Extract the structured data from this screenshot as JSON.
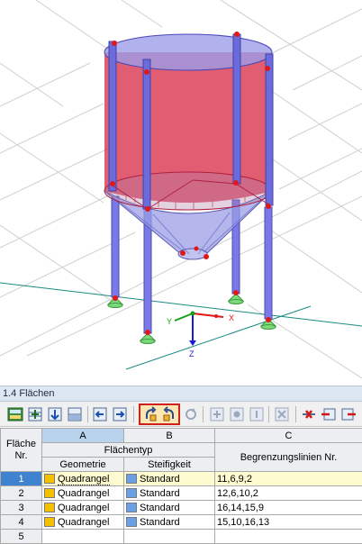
{
  "viewport": {
    "axis_y_label": "Y",
    "axis_x_label": "X",
    "axis_z_label": "Z"
  },
  "panel": {
    "title": "1.4 Flächen"
  },
  "toolbar": {
    "buttons": [
      "table-view-icon",
      "insert-row-icon",
      "export-icon",
      "import-icon",
      "prev-icon",
      "next-icon",
      "rotate-left-icon",
      "rotate-right-icon",
      "refresh-icon",
      "zoom-icon",
      "settings-icon",
      "filter-icon",
      "select-icon",
      "delete-icon",
      "delete-row-icon",
      "insert-col-icon"
    ]
  },
  "table": {
    "col_letters": [
      "A",
      "B",
      "C"
    ],
    "rowhead_line1": "Fläche",
    "rowhead_line2": "Nr.",
    "group_header": "Flächentyp",
    "col_headers": [
      "Geometrie",
      "Steifigkeit",
      "Begrenzungslinien Nr."
    ],
    "rows": [
      {
        "nr": "1",
        "geometrie": "Quadrangel",
        "steifigkeit": "Standard",
        "linien": "11,6,9,2"
      },
      {
        "nr": "2",
        "geometrie": "Quadrangel",
        "steifigkeit": "Standard",
        "linien": "12,6,10,2"
      },
      {
        "nr": "3",
        "geometrie": "Quadrangel",
        "steifigkeit": "Standard",
        "linien": "16,14,15,9"
      },
      {
        "nr": "4",
        "geometrie": "Quadrangel",
        "steifigkeit": "Standard",
        "linien": "15,10,16,13"
      },
      {
        "nr": "5",
        "geometrie": "",
        "steifigkeit": "",
        "linien": ""
      }
    ],
    "selected_row": "1"
  },
  "colors": {
    "silo_red": "#d9304a",
    "silo_blue": "#8a8ce0",
    "column_blue": "#7070e0",
    "support_green": "#7ed87e",
    "node_red": "#e01818",
    "grid_line": "#c8c8c8",
    "axis_teal": "#1a8a80"
  }
}
